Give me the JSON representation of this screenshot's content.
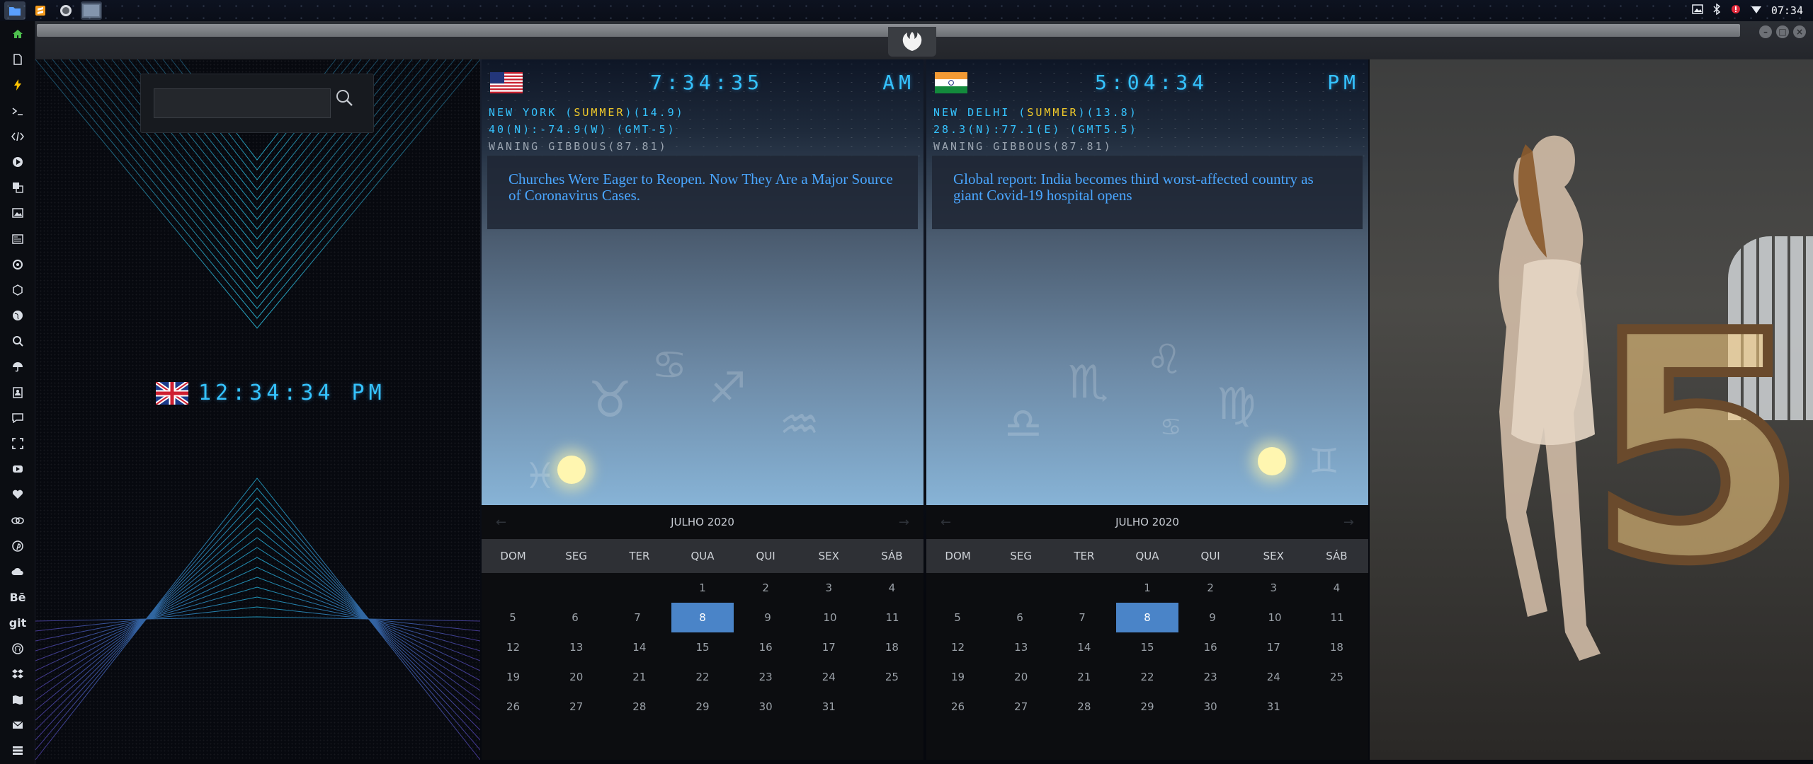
{
  "taskbar": {
    "apps": [
      "folder",
      "sublime",
      "synergy",
      "desktop-thumbnail"
    ],
    "clock": "07:34"
  },
  "dock": {
    "items": [
      "home",
      "file",
      "bolt",
      "terminal",
      "code",
      "play",
      "translate",
      "image",
      "news",
      "settings",
      "hexagon",
      "globe",
      "search",
      "umbrella",
      "contacts",
      "chat",
      "expand",
      "youtube",
      "heart",
      "link",
      "pinterest",
      "cloud",
      "Bē",
      "git",
      "github",
      "dropbox",
      "map",
      "mail",
      "storage"
    ]
  },
  "panel_search": {
    "placeholder": "",
    "value": ""
  },
  "uk_clock": {
    "time": "12:34:34 PM"
  },
  "new_york": {
    "time": "7:34:35",
    "ampm": "AM",
    "city_prefix": "NEW YORK (",
    "season": "SUMMER",
    "city_suffix": ")(14.9)",
    "coords": "40(N):-74.9(W) (GMT-5)",
    "moon": "WANING GIBBOUS(87.81)",
    "headline": "Churches Were Eager to Reopen. Now They Are a Major Source of Coronavirus Cases."
  },
  "new_delhi": {
    "time": "5:04:34",
    "ampm": "PM",
    "city_prefix": "NEW DELHI (",
    "season": "SUMMER",
    "city_suffix": ")(13.8)",
    "coords": "28.3(N):77.1(E) (GMT5.5)",
    "moon": "WANING GIBBOUS(87.81)",
    "headline": "Global report: India becomes third worst-affected country as giant Covid-19 hospital opens"
  },
  "calendar": {
    "month": "JULHO 2020",
    "weekdays": [
      "DOM",
      "SEG",
      "TER",
      "QUA",
      "QUI",
      "SEX",
      "SÁB"
    ],
    "weeks": [
      [
        "",
        "",
        "",
        "1",
        "2",
        "3",
        "4"
      ],
      [
        "5",
        "6",
        "7",
        "8",
        "9",
        "10",
        "11"
      ],
      [
        "12",
        "13",
        "14",
        "15",
        "16",
        "17",
        "18"
      ],
      [
        "19",
        "20",
        "21",
        "22",
        "23",
        "24",
        "25"
      ],
      [
        "26",
        "27",
        "28",
        "29",
        "30",
        "31",
        ""
      ]
    ],
    "today": "8"
  },
  "photo": {
    "sign_text": "5"
  },
  "colors": {
    "digital": "#35c3ff",
    "season": "#f3cb2a",
    "headline": "#4aa6ff",
    "today": "#4a84c8"
  }
}
